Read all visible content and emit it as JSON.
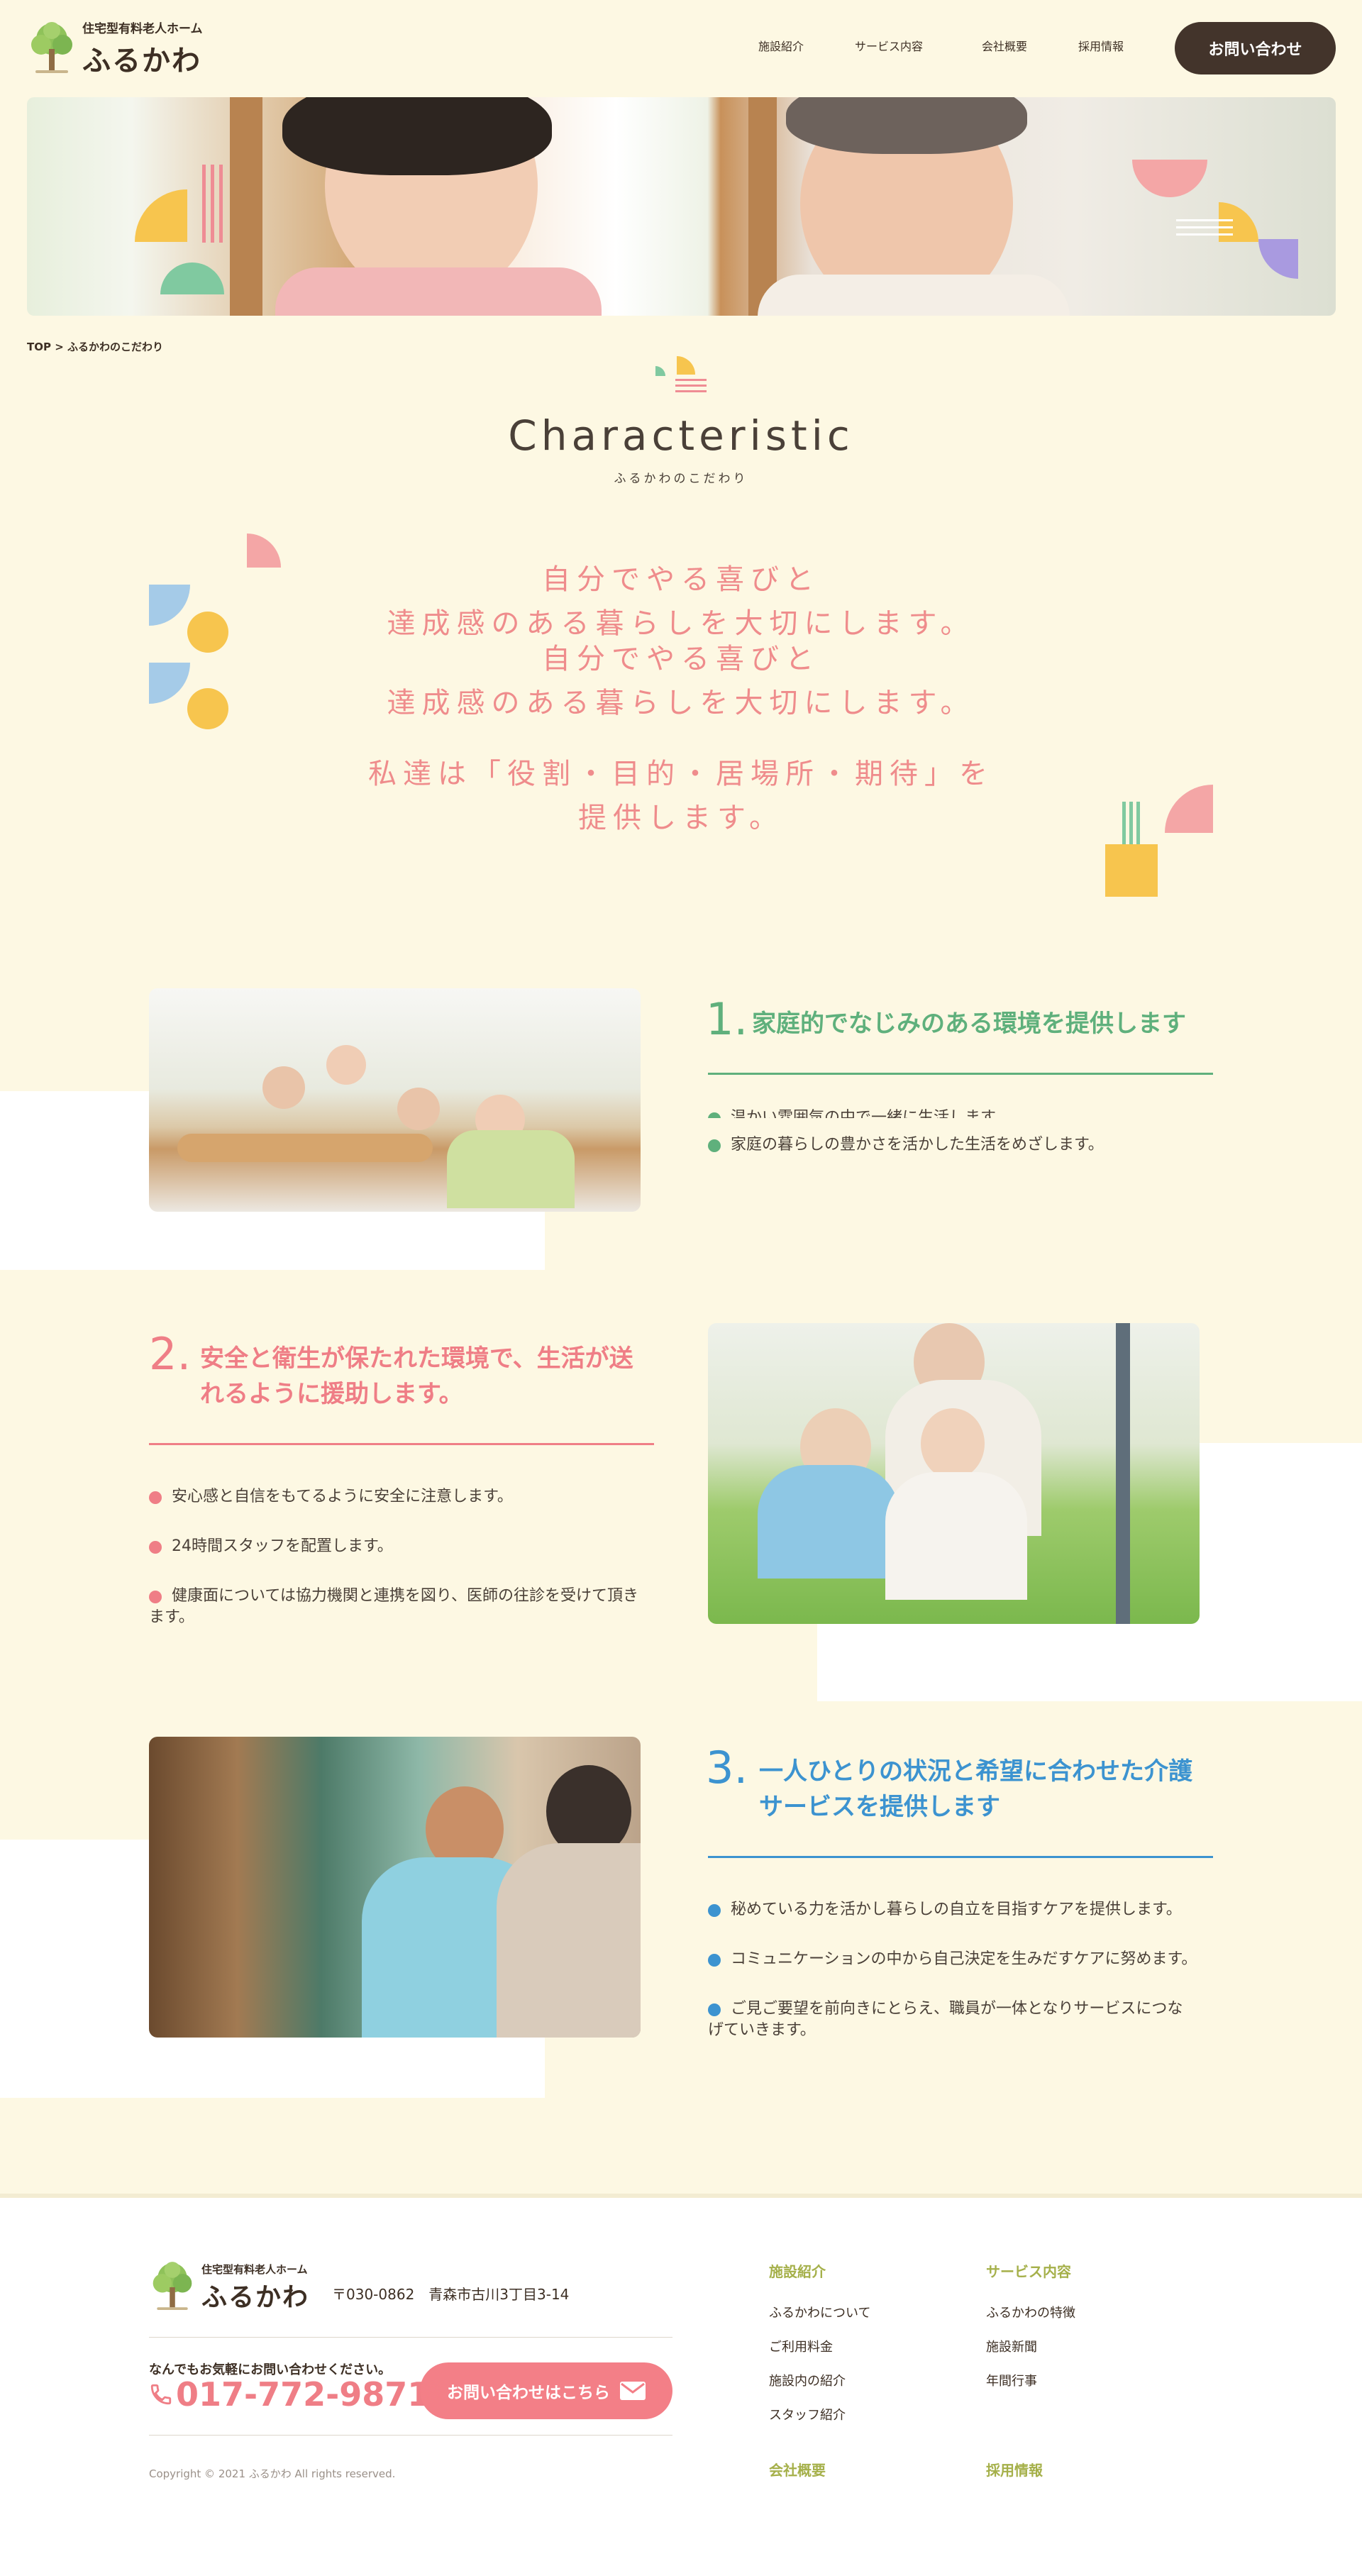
{
  "header": {
    "logo_sub": "住宅型有料老人ホーム",
    "logo_main": "ふるかわ",
    "nav": [
      "施設紹介",
      "サービス内容",
      "会社概要",
      "採用情報"
    ],
    "contact_label": "お問い合わせ"
  },
  "breadcrumb": "TOP > ふるかわのこだわり",
  "title": {
    "main": "Characteristic",
    "sub": "ふるかわのこだわり"
  },
  "lead": {
    "line1": "自分でやる喜びと",
    "line2": "達成感のある暮らしを大切にします。",
    "line3": "私達は「役割・目的・居場所・期待」を",
    "line4": "提供します。"
  },
  "features": [
    {
      "number": "1.",
      "title": "家庭的でなじみのある環境を提供します",
      "bullets": [
        "温かい雰囲気の中で一緒に生活します。",
        "家庭の暮らしの豊かさを活かした生活をめざします。"
      ]
    },
    {
      "number": "2.",
      "title_l1": "安全と衛生が保たれた環境で、生活が送",
      "title_l2": "れるように援助します。",
      "bullets": [
        "安心感と自信をもてるように安全に注意します。",
        "24時間スタッフを配置します。",
        "健康面については協力機関と連携を図り、医師の往診を受けて頂き",
        "ます。"
      ]
    },
    {
      "number": "3.",
      "title_l1": "一人ひとりの状況と希望に合わせた介護",
      "title_l2": "サービスを提供します",
      "bullets": [
        "秘めている力を活かし暮らしの自立を目指すケアを提供します。",
        "コミュニケーションの中から自己決定を生みだすケアに努めます。",
        "ご見ご要望を前向きにとらえ、職員が一体となりサービスにつな",
        "げていきます。"
      ]
    }
  ],
  "footer": {
    "logo_sub": "住宅型有料老人ホーム",
    "logo_main": "ふるかわ",
    "address": "〒030-0862　青森市古川3丁目3-14",
    "contact_note": "なんでもお気軽にお問い合わせください。",
    "phone": "017-772-9871",
    "button_label": "お問い合わせはこちら",
    "copyright": "Copyright © 2021 ふるかわ All rights reserved.",
    "col1_heading": "施設紹介",
    "col1_links": [
      "ふるかわについて",
      "ご利用料金",
      "施設内の紹介",
      "スタッフ紹介"
    ],
    "col2_heading": "サービス内容",
    "col2_links": [
      "ふるかわの特徴",
      "施設新聞",
      "年間行事"
    ],
    "col3_heading": "会社概要",
    "col4_heading": "採用情報"
  },
  "colors": {
    "background": "#fdf8e3",
    "brown": "#43342b",
    "green": "#5fb07c",
    "pink": "#ef7e86",
    "blue": "#3c93d0",
    "yellow": "#f7c54e",
    "olive": "#a5b04a"
  },
  "icons": [
    "tree-logo-icon",
    "phone-icon",
    "mail-icon"
  ]
}
